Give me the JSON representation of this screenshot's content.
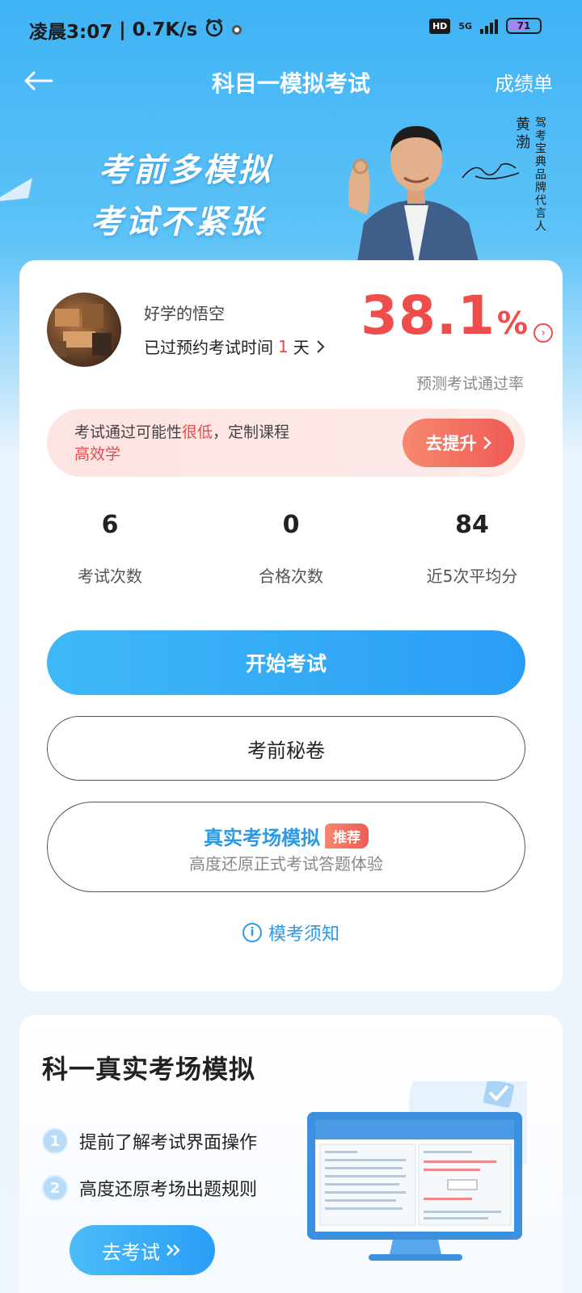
{
  "status_bar": {
    "time": "凌晨3:07",
    "speed": "0.7K/s",
    "hd": "HD",
    "network": "5G",
    "battery": "71"
  },
  "nav": {
    "title": "科目一模拟考试",
    "action": "成绩单"
  },
  "banner": {
    "slogan_line1": "考前多模拟",
    "slogan_line2": "考试不紧张",
    "endorser_name": "黄渤",
    "brand_line": "驾考宝典品牌代言人"
  },
  "profile": {
    "user_name": "好学的悟空",
    "appointment_prefix": "已过预约考试时间",
    "appointment_days": "1",
    "appointment_suffix": "天",
    "pass_rate": "38.1",
    "pass_rate_unit": "%",
    "pass_rate_label": "预测考试通过率"
  },
  "tip": {
    "prefix": "考试通过可能性",
    "highlight": "很低",
    "middle": "，定制课程",
    "link": "高效学",
    "button": "去提升"
  },
  "stats": [
    {
      "value": "6",
      "label": "考试次数"
    },
    {
      "value": "0",
      "label": "合格次数"
    },
    {
      "value": "84",
      "label": "近5次平均分"
    }
  ],
  "actions": {
    "start_exam": "开始考试",
    "secret_paper": "考前秘卷",
    "real_sim_title": "真实考场模拟",
    "real_sim_badge": "推荐",
    "real_sim_sub": "高度还原正式考试答题体验",
    "notice": "模考须知"
  },
  "promo": {
    "title": "科一真实考场模拟",
    "features": [
      {
        "num": "1",
        "text": "提前了解考试界面操作"
      },
      {
        "num": "2",
        "text": "高度还原考场出题规则"
      }
    ],
    "button": "去考试"
  },
  "colors": {
    "primary_blue": "#2a9ef6",
    "accent_red": "#ef4c4c"
  }
}
